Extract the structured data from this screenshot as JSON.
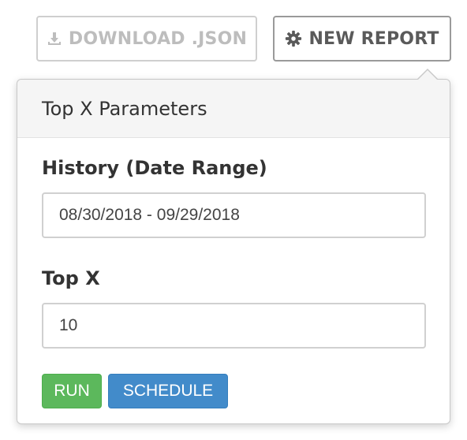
{
  "toolbar": {
    "download_label": "DOWNLOAD .JSON",
    "download_icon": "download-icon",
    "new_report_label": "NEW REPORT",
    "new_report_icon": "gear-icon"
  },
  "popover": {
    "title": "Top X Parameters",
    "history_label": "History (Date Range)",
    "history_value": "08/30/2018 - 09/29/2018",
    "topx_label": "Top X",
    "topx_value": "10",
    "run_label": "RUN",
    "schedule_label": "SCHEDULE"
  },
  "colors": {
    "run": "#5cb85c",
    "schedule": "#428bca",
    "disabled_text": "#bdbdbd"
  }
}
